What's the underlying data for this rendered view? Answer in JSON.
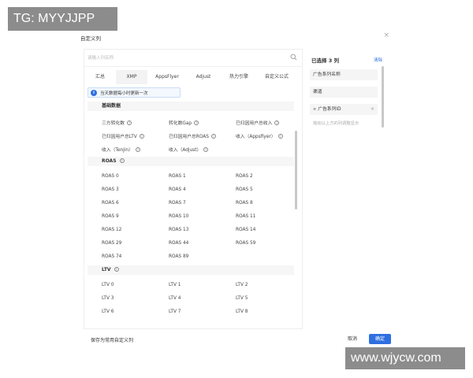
{
  "watermarks": {
    "top_left": "TG: MYYJJPP",
    "bottom_right": "www.wjycw.com"
  },
  "dialog": {
    "title": "自定义列",
    "close_icon": "close-icon"
  },
  "search": {
    "placeholder": "请输入列名称",
    "icon": "search-icon"
  },
  "tabs": [
    {
      "label": "汇总",
      "active": false
    },
    {
      "label": "XMP",
      "active": true
    },
    {
      "label": "AppsFlyer",
      "active": false
    },
    {
      "label": "Adjust",
      "active": false
    },
    {
      "label": "热力引擎",
      "active": false
    },
    {
      "label": "自定义公式",
      "active": false
    }
  ],
  "notice": {
    "text": "当天数据每小时更新一次"
  },
  "groups": {
    "basic": {
      "title": "基础数据",
      "items": [
        "三方转化数",
        "转化数Gap",
        "已归因用户总收入",
        "已归因用户总LTV",
        "已归因用户总ROAS",
        "收入（Appsflyer）",
        "收入（Tenjin）",
        "收入（Adjust）"
      ]
    },
    "roas": {
      "title": "ROAS",
      "items": [
        "ROAS 0",
        "ROAS 1",
        "ROAS 2",
        "ROAS 3",
        "ROAS 4",
        "ROAS 5",
        "ROAS 6",
        "ROAS 7",
        "ROAS 8",
        "ROAS 9",
        "ROAS 10",
        "ROAS 11",
        "ROAS 12",
        "ROAS 13",
        "ROAS 14",
        "ROAS 29",
        "ROAS 44",
        "ROAS 59",
        "ROAS 74",
        "ROAS 89"
      ]
    },
    "ltv": {
      "title": "LTV",
      "items": [
        "LTV 0",
        "LTV 1",
        "LTV 2",
        "LTV 3",
        "LTV 4",
        "LTV 5",
        "LTV 6",
        "LTV 7",
        "LTV 8"
      ]
    }
  },
  "selected": {
    "title": "已选择 3 列",
    "clear_label": "清除",
    "items": [
      "广告系列名称",
      "渠道",
      "广告系列ID"
    ],
    "hint": "拖动以上方的列调整显示"
  },
  "footer": {
    "save_label": "保存为常用自定义列",
    "cancel_label": "取消",
    "ok_label": "确定"
  },
  "colors": {
    "primary": "#2f6fe0",
    "notice_bg": "#f3f8ff",
    "watermark_bg": "#8c8c8c"
  }
}
